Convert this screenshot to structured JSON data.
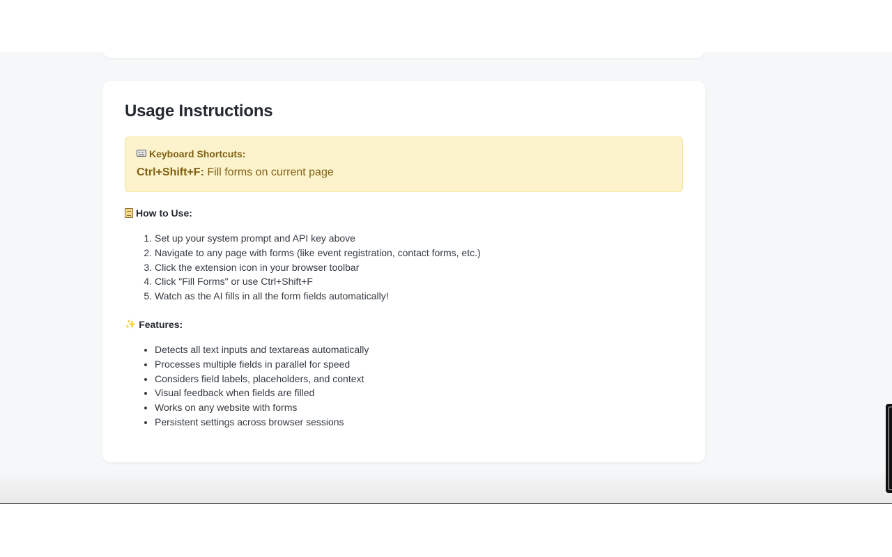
{
  "usage": {
    "title": "Usage Instructions",
    "shortcuts": {
      "heading": "Keyboard Shortcuts:",
      "icon": "keyboard-icon",
      "key": "Ctrl+Shift+F:",
      "description": "Fill forms on current page"
    },
    "how_to": {
      "heading": "How to Use:",
      "icon": "clipboard-icon",
      "steps": [
        "Set up your system prompt and API key above",
        "Navigate to any page with forms (like event registration, contact forms, etc.)",
        "Click the extension icon in your browser toolbar",
        "Click \"Fill Forms\" or use Ctrl+Shift+F",
        "Watch as the AI fills in all the form fields automatically!"
      ]
    },
    "features": {
      "heading": "Features:",
      "icon": "sparkles-icon",
      "items": [
        "Detects all text inputs and textareas automatically",
        "Processes multiple fields in parallel for speed",
        "Considers field labels, placeholders, and context",
        "Visual feedback when fields are filled",
        "Works on any website with forms",
        "Persistent settings across browser sessions"
      ]
    }
  },
  "colors": {
    "page_background": "#f6f7f8",
    "card_background": "#ffffff",
    "shortcut_background": "#fcf3cd",
    "shortcut_border": "#f6e39a",
    "shortcut_text": "#806012"
  }
}
